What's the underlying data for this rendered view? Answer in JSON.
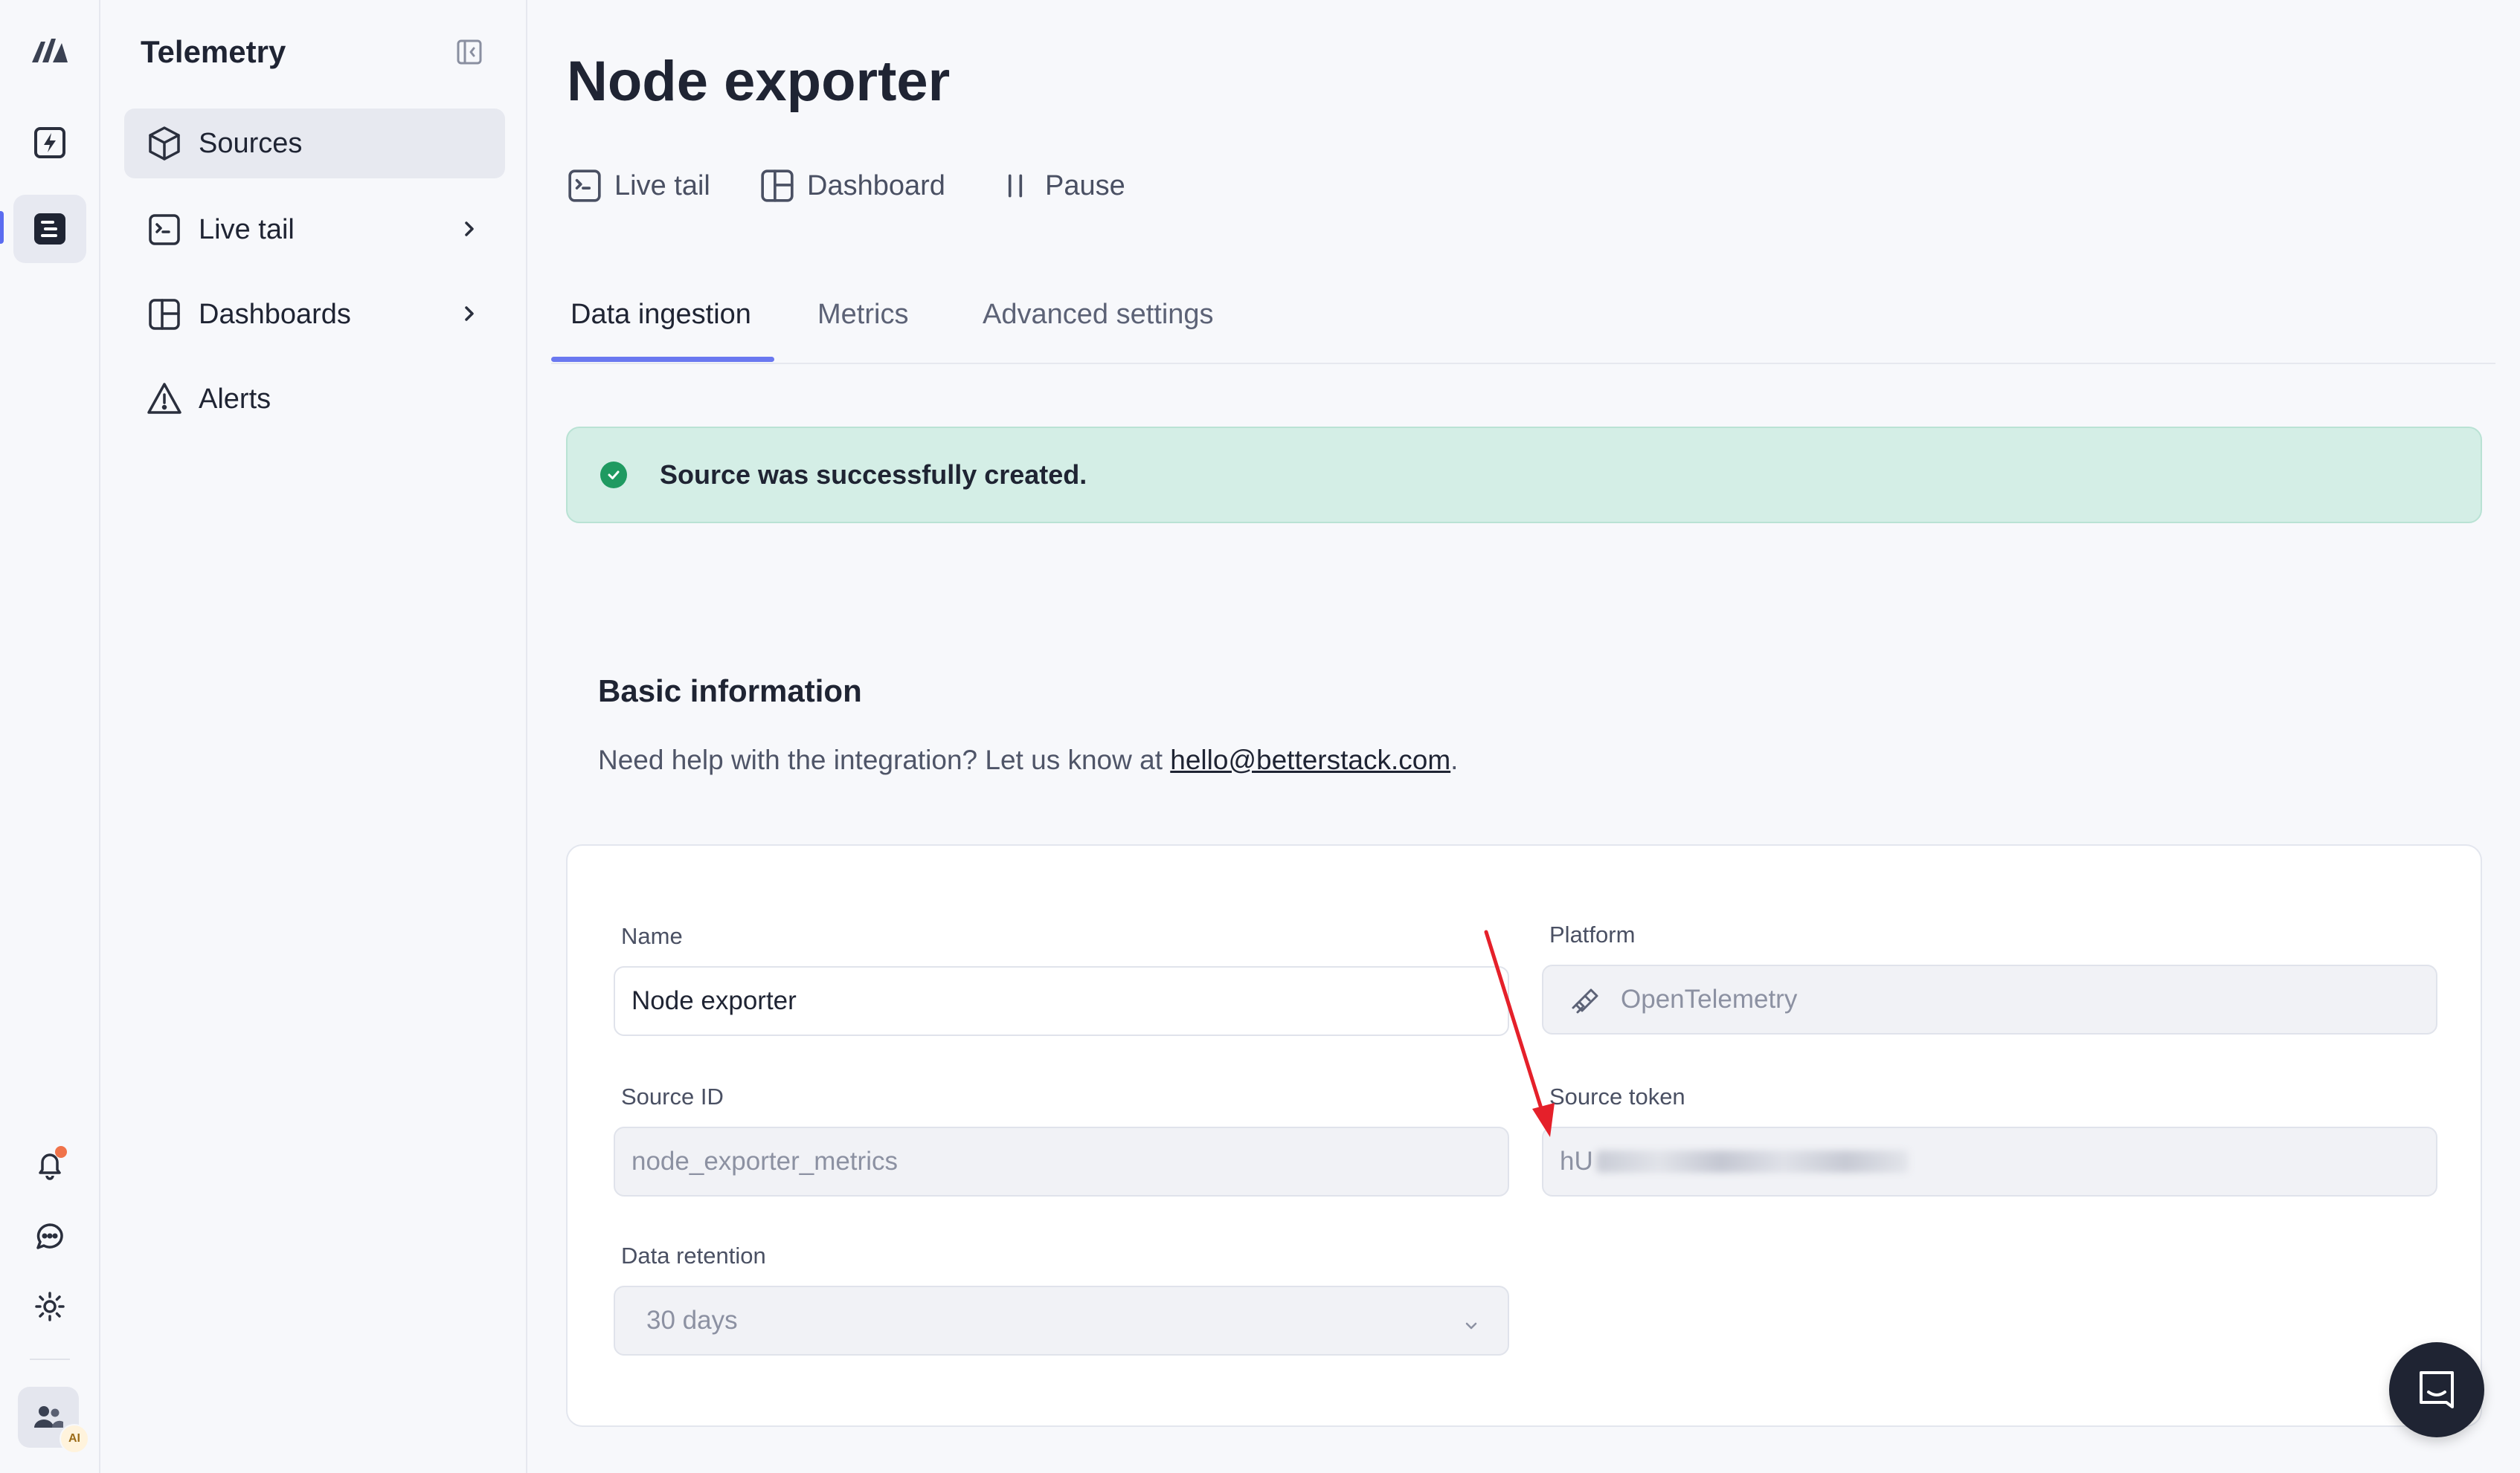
{
  "sidebar": {
    "title": "Telemetry",
    "items": [
      {
        "label": "Sources",
        "active": true
      },
      {
        "label": "Live tail",
        "has_submenu": true
      },
      {
        "label": "Dashboards",
        "has_submenu": true
      },
      {
        "label": "Alerts"
      }
    ]
  },
  "rail": {
    "icons": [
      "logo-icon",
      "uptime-bolt-icon",
      "telemetry-icon",
      "bell-icon",
      "chat-icon",
      "sun-icon",
      "team-icon"
    ],
    "ai_badge": "AI"
  },
  "page": {
    "title": "Node exporter",
    "actions": [
      {
        "label": "Live tail",
        "icon": "terminal-icon"
      },
      {
        "label": "Dashboard",
        "icon": "dashboard-icon"
      },
      {
        "label": "Pause",
        "icon": "pause-icon"
      }
    ],
    "tabs": [
      {
        "label": "Data ingestion",
        "active": true
      },
      {
        "label": "Metrics"
      },
      {
        "label": "Advanced settings"
      }
    ]
  },
  "alert": {
    "message": "Source was successfully created.",
    "color": "#d4eee6"
  },
  "basic_info": {
    "title": "Basic information",
    "help_prefix": "Need help with the integration? Let us know at ",
    "help_email": "hello@betterstack.com",
    "help_suffix": "."
  },
  "form": {
    "name": {
      "label": "Name",
      "value": "Node exporter"
    },
    "platform": {
      "label": "Platform",
      "value": "OpenTelemetry",
      "icon": "telescope-icon"
    },
    "source_id": {
      "label": "Source ID",
      "value": "node_exporter_metrics"
    },
    "source_token": {
      "label": "Source token",
      "visible_prefix": "hU"
    },
    "retention": {
      "label": "Data retention",
      "value": "30 days"
    }
  },
  "colors": {
    "accent": "#6a78f0",
    "success": "#1f9a61",
    "annotation_arrow": "#e5202a"
  }
}
